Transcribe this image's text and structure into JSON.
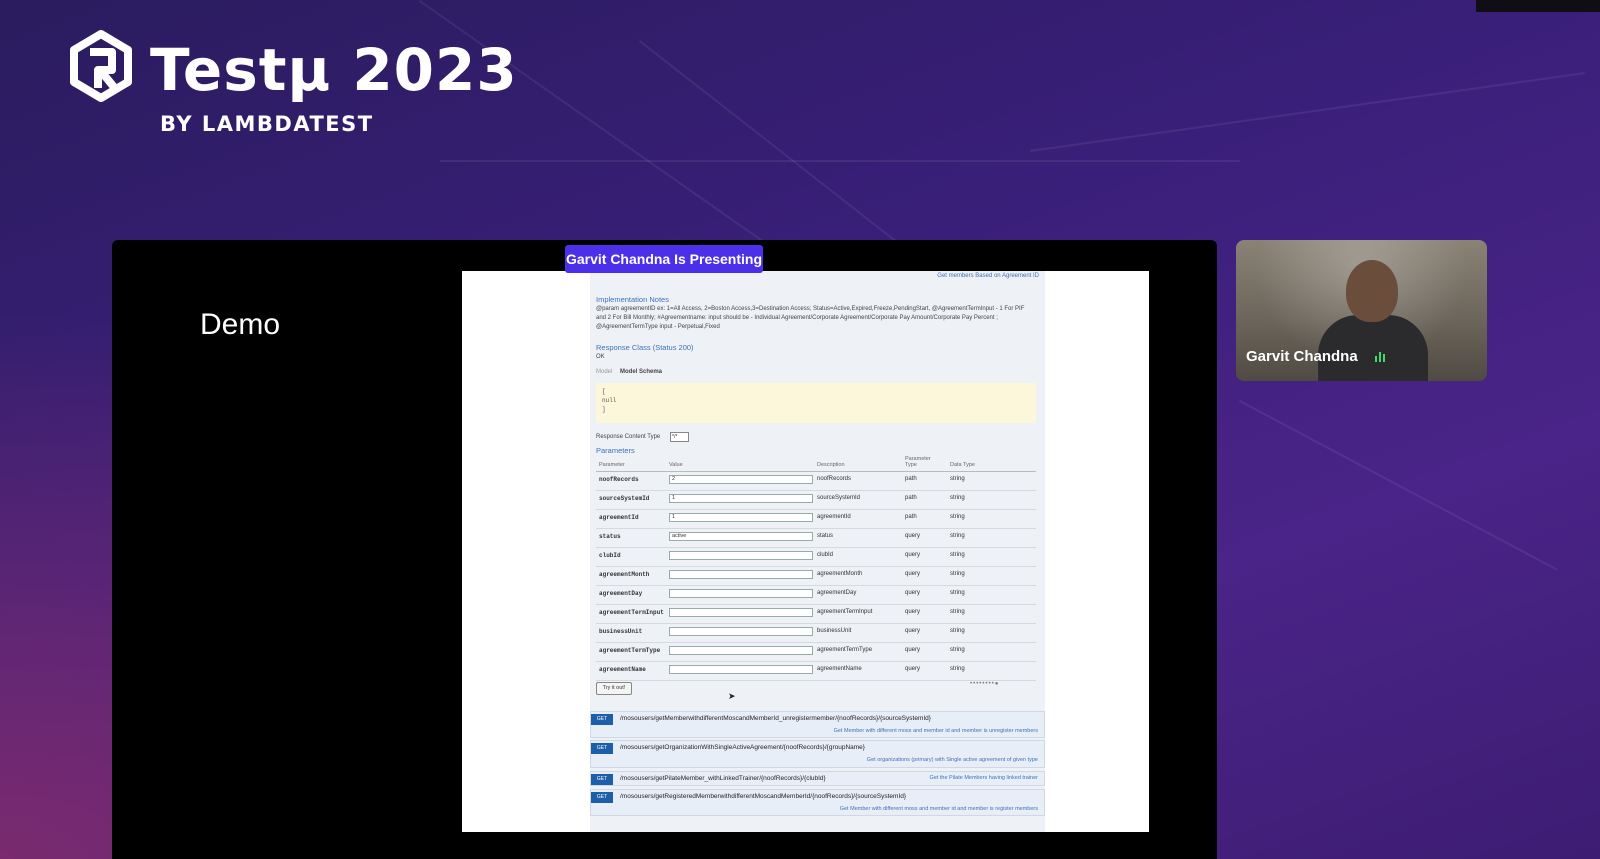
{
  "branding": {
    "title": "Testμ 2023",
    "subtitle": "BY LAMBDATEST",
    "logo_icon": "lambdatest-logo-icon"
  },
  "stage": {
    "slide_title": "Demo",
    "presenting_badge": "Garvit Chandna Is Presenting"
  },
  "shared_screen": {
    "top_link": "Get members Based on Agreement ID",
    "implementation_heading": "Implementation Notes",
    "implementation_text": "@param agreementID ex: 1=All Access, 2=Boston Access,3=Destination Access; Status=Active,Expired,Freeze,PendingStart, @AgreementTermInput - 1 For PIF and 2 For Bill Monthly; #Agreementname: input should be - Individual Agreement/Corporate Agreement/Corporate Pay Amount/Corporate Pay Percent ; @AgreementTermType input - Perpetual,Fixed",
    "response_class_heading": "Response Class (Status 200)",
    "response_class_text": "OK",
    "model_label": "Model",
    "model_schema_label": "Model Schema",
    "code_lines": [
      "[",
      "  null",
      "]"
    ],
    "response_content_type_label": "Response Content Type",
    "response_content_type_value": "*/*",
    "parameters_heading": "Parameters",
    "table_headers": {
      "parameter": "Parameter",
      "value": "Value",
      "description": "Description",
      "parameter_type": "Parameter Type",
      "data_type": "Data Type"
    },
    "parameters": [
      {
        "name": "noofRecords",
        "value": "2",
        "description": "noofRecords",
        "type": "path",
        "data_type": "string"
      },
      {
        "name": "sourceSystemId",
        "value": "1",
        "description": "sourceSystemId",
        "type": "path",
        "data_type": "string"
      },
      {
        "name": "agreementId",
        "value": "1",
        "description": "agreementId",
        "type": "path",
        "data_type": "string"
      },
      {
        "name": "status",
        "value": "active",
        "description": "status",
        "type": "query",
        "data_type": "string"
      },
      {
        "name": "clubId",
        "value": "",
        "description": "clubId",
        "type": "query",
        "data_type": "string"
      },
      {
        "name": "agreementMonth",
        "value": "",
        "description": "agreementMonth",
        "type": "query",
        "data_type": "string"
      },
      {
        "name": "agreementDay",
        "value": "",
        "description": "agreementDay",
        "type": "query",
        "data_type": "string"
      },
      {
        "name": "agreementTermInput",
        "value": "",
        "description": "agreementTermInput",
        "type": "query",
        "data_type": "string"
      },
      {
        "name": "businessUnit",
        "value": "",
        "description": "businessUnit",
        "type": "query",
        "data_type": "string"
      },
      {
        "name": "agreementTermType",
        "value": "",
        "description": "agreementTermType",
        "type": "query",
        "data_type": "string"
      },
      {
        "name": "agreementName",
        "value": "",
        "description": "agreementName",
        "type": "query",
        "data_type": "string"
      }
    ],
    "try_button": "Try it out!",
    "operations": [
      {
        "method": "GET",
        "path": "/mosousers/getMemberwithdifferentMoscandMemberId_unregistermember/{noofRecords}/{sourceSystemId}",
        "description": "Get Member with different moss and member id and member is unregister members"
      },
      {
        "method": "GET",
        "path": "/mosousers/getOrganizationWithSingleActiveAgreement/{noofRecords}/{groupName}",
        "description": "Get organizations (primary) with Single active agreement of given type"
      },
      {
        "method": "GET",
        "path": "/mosousers/getPilateMember_withLinkedTrainer/{noofRecords}/{clubId}",
        "description": "Get the Pilate Members having linked trainer"
      },
      {
        "method": "GET",
        "path": "/mosousers/getRegisteredMemberwithdifferentMoscandMemberId/{noofRecords}/{sourceSystemId}",
        "description": "Get Member with different moss and member id and member is register members"
      }
    ]
  },
  "participant": {
    "name": "Garvit Chandna",
    "mic_icon": "mic-active-icon"
  },
  "colors": {
    "accent": "#4c2fe8",
    "swagger_link": "#3a73b8",
    "get_badge": "#1c5fa8"
  }
}
